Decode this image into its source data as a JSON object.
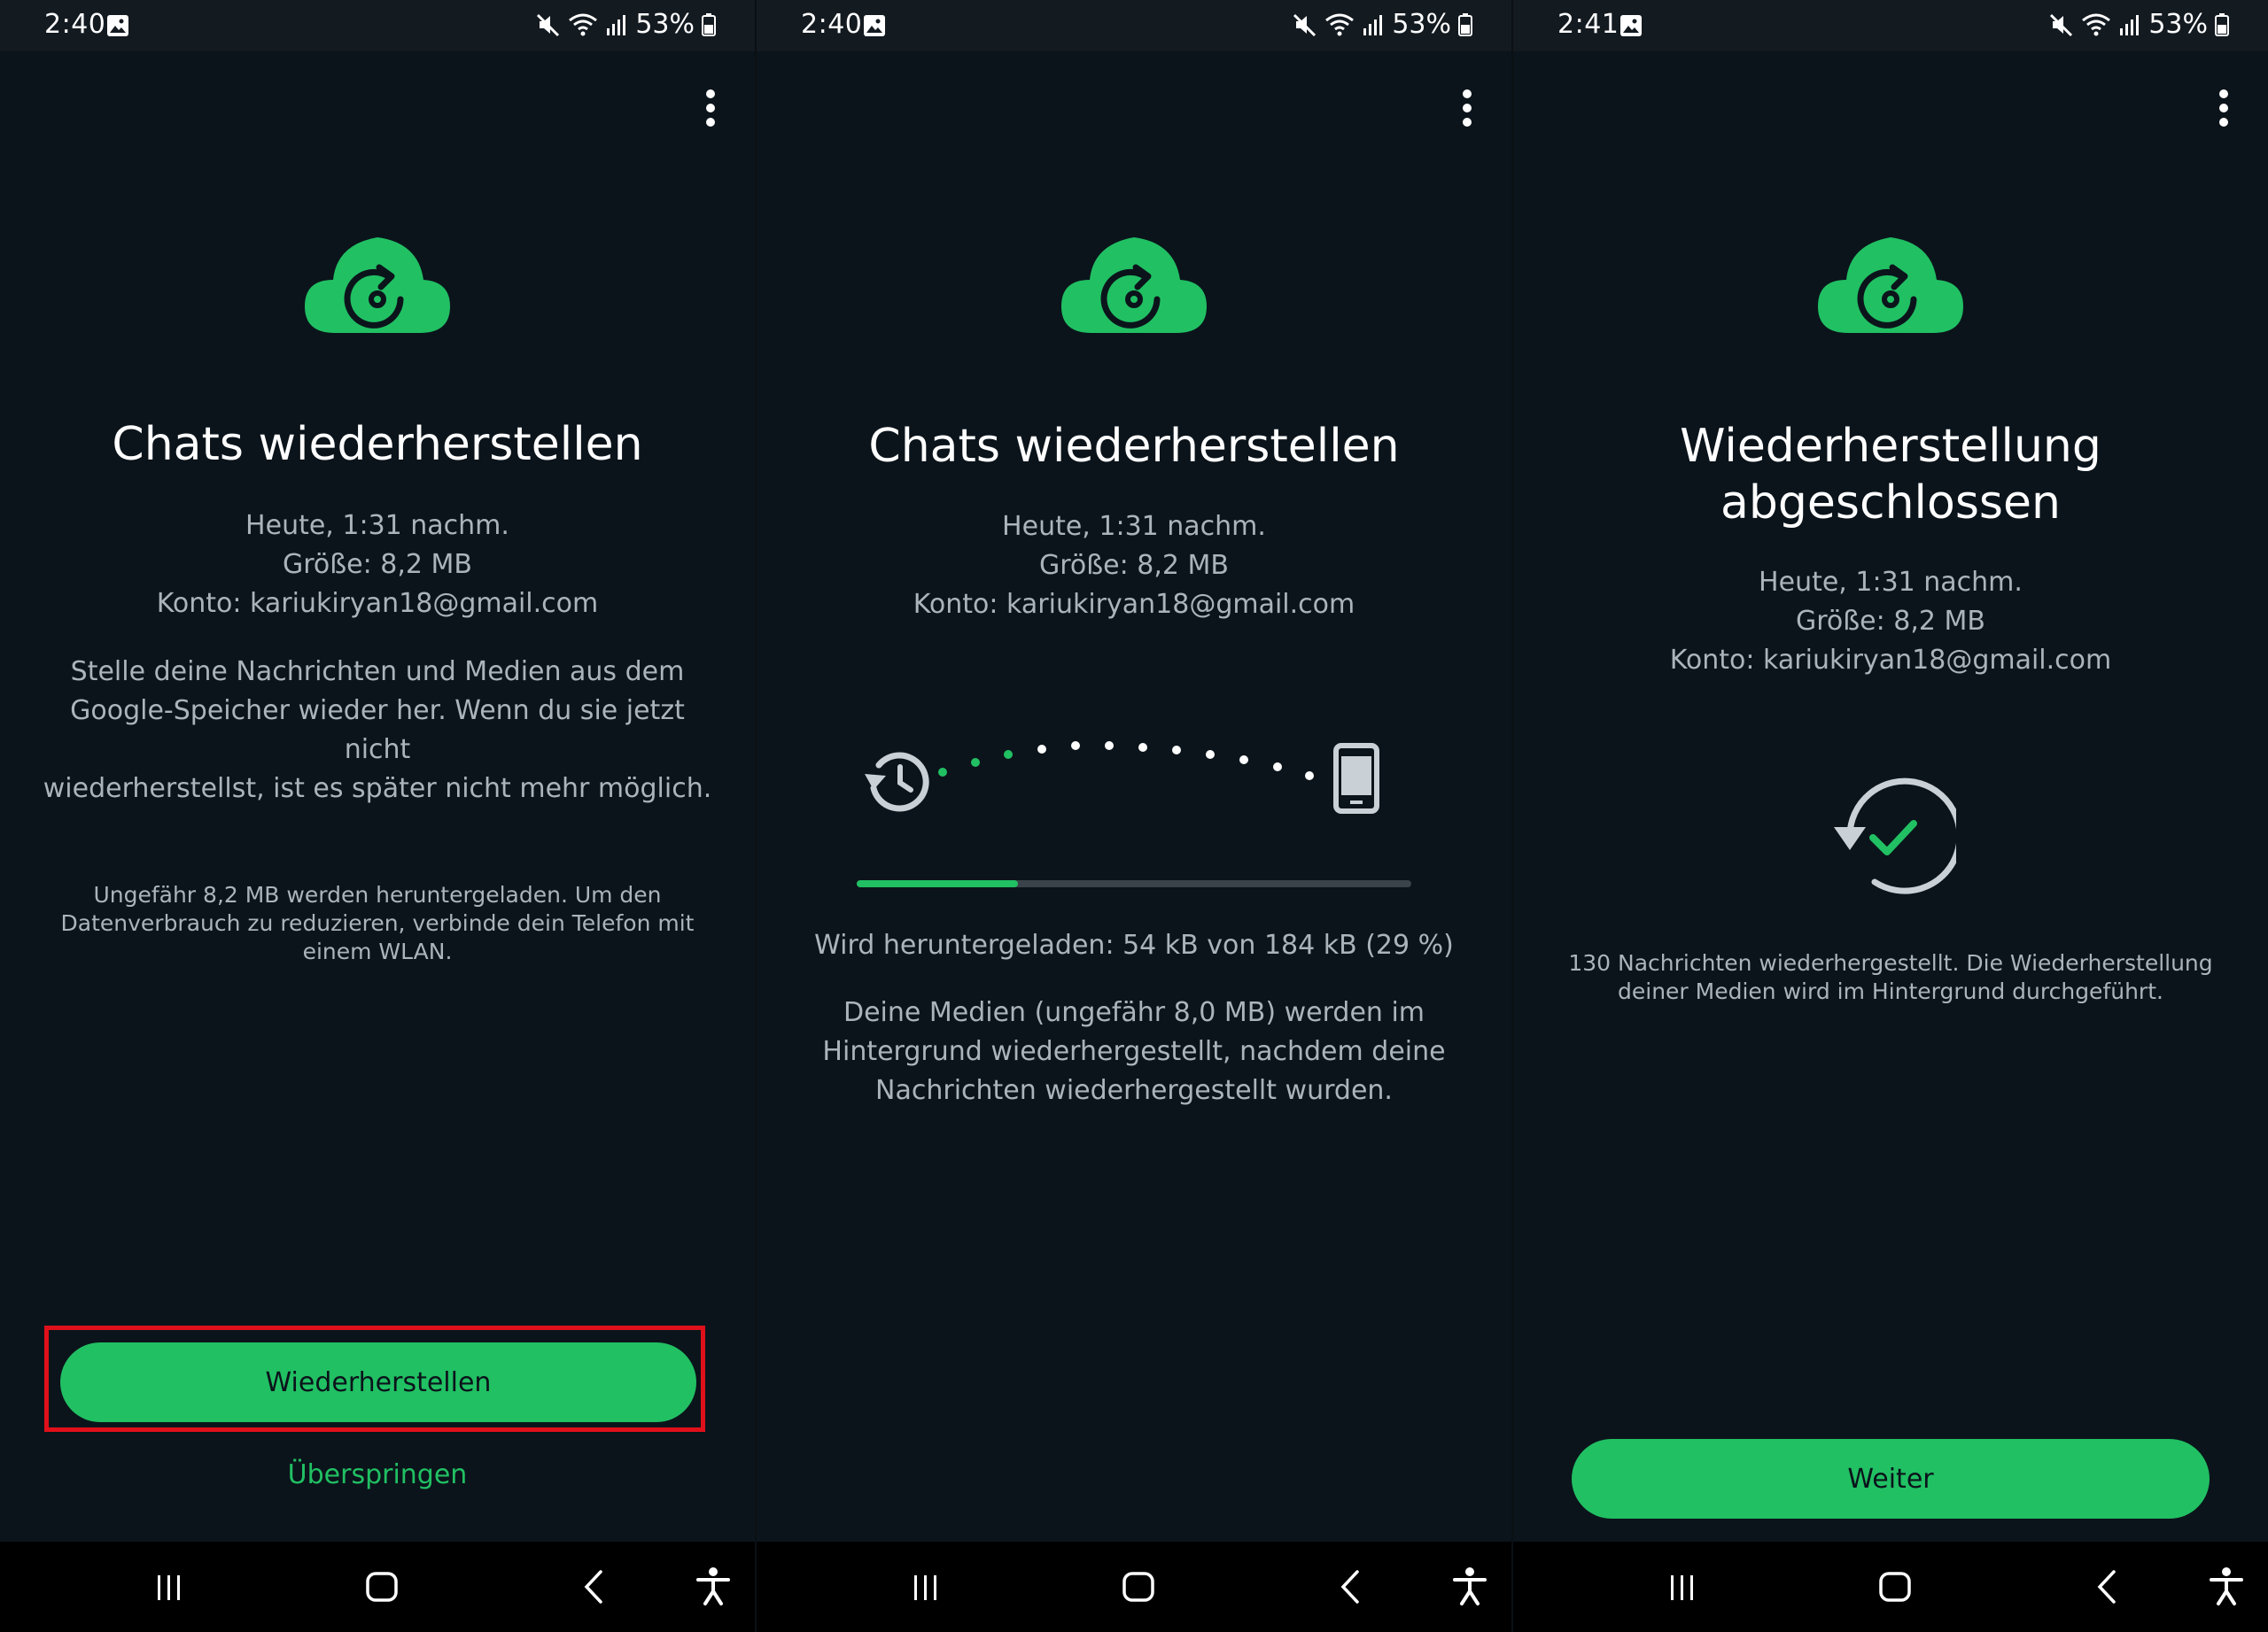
{
  "colors": {
    "accent": "#21c063",
    "background": "#0b141b",
    "highlight_border": "#e0101a"
  },
  "panels": [
    {
      "status_bar": {
        "time": "2:40",
        "battery": "53%"
      },
      "title": "Chats wiederherstellen",
      "backup_info": {
        "date": "Heute, 1:31 nachm.",
        "size": "Größe: 8,2 MB",
        "account": "Konto: kariukiryan18@gmail.com"
      },
      "description_lines": [
        "Stelle deine Nachrichten und Medien aus dem",
        "Google-Speicher wieder her. Wenn du sie jetzt nicht",
        "wiederherstellst, ist es später nicht mehr möglich."
      ],
      "data_notice_lines": [
        "Ungefähr 8,2 MB werden heruntergeladen. Um den",
        "Datenverbrauch zu reduzieren, verbinde dein Telefon mit",
        "einem WLAN."
      ],
      "primary_button": "Wiederherstellen",
      "skip_link": "Überspringen"
    },
    {
      "status_bar": {
        "time": "2:40",
        "battery": "53%"
      },
      "title": "Chats wiederherstellen",
      "backup_info": {
        "date": "Heute, 1:31 nachm.",
        "size": "Größe: 8,2 MB",
        "account": "Konto: kariukiryan18@gmail.com"
      },
      "progress_fraction": 0.29,
      "progress_text": "Wird heruntergeladen: 54 kB von 184 kB (29 %)",
      "media_notice_lines": [
        "Deine Medien (ungefähr 8,0 MB) werden im",
        "Hintergrund wiederhergestellt, nachdem deine",
        "Nachrichten wiederhergestellt wurden."
      ]
    },
    {
      "status_bar": {
        "time": "2:41",
        "battery": "53%"
      },
      "title_lines": [
        "Wiederherstellung",
        "abgeschlossen"
      ],
      "backup_info": {
        "date": "Heute, 1:31 nachm.",
        "size": "Größe: 8,2 MB",
        "account": "Konto: kariukiryan18@gmail.com"
      },
      "result_lines": [
        "130 Nachrichten wiederhergestellt. Die Wiederherstellung",
        "deiner Medien wird im Hintergrund durchgeführt."
      ],
      "primary_button": "Weiter"
    }
  ],
  "icons": {
    "menu": "more-vert-icon",
    "cloud": "cloud-restore-icon",
    "history": "history-icon",
    "phone": "smartphone-icon",
    "done": "restore-done-icon",
    "nav": [
      "recents-icon",
      "home-icon",
      "back-icon",
      "accessibility-icon"
    ]
  }
}
